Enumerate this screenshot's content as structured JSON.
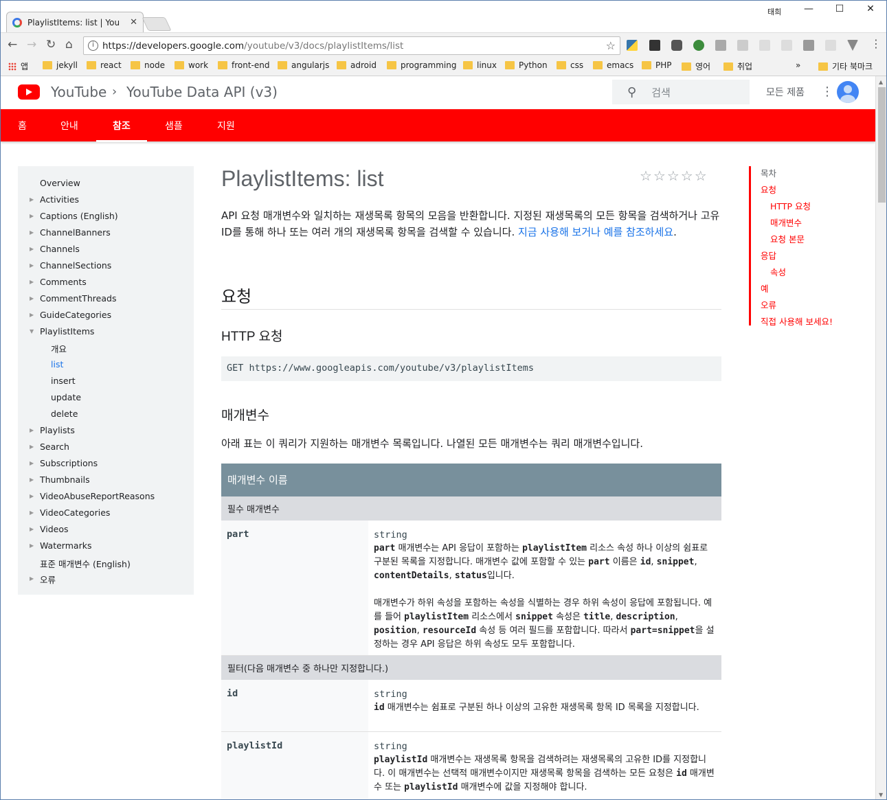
{
  "browser": {
    "tab_title": "PlaylistItems: list  |  You",
    "close_glyph": "✕",
    "profile_name": "태희",
    "window_buttons": [
      "—",
      "☐",
      "✕"
    ],
    "url_host": "https://developers.google.com",
    "url_path": "/youtube/v3/docs/playlistItems/list",
    "bookmarks": [
      "앱",
      "jekyll",
      "react",
      "node",
      "work",
      "front-end",
      "angularjs",
      "adroid",
      "programming",
      "linux",
      "Python",
      "css",
      "emacs",
      "PHP",
      "영어",
      "취업"
    ],
    "bookmarks_more": "»",
    "other_bookmarks": "기타 북마크",
    "icons": [
      "back-icon",
      "forward-icon",
      "reload-icon",
      "home-icon",
      "info-icon",
      "star-icon"
    ]
  },
  "header": {
    "brand": "YouTube",
    "separator": "›",
    "product": "YouTube Data API (v3)",
    "search_placeholder": "검색",
    "all_products": "모든 제품"
  },
  "nav": {
    "items": [
      "홈",
      "안내",
      "참조",
      "샘플",
      "지원"
    ],
    "active": "참조"
  },
  "sidebar": {
    "items": [
      {
        "label": "Overview"
      },
      {
        "label": "Activities"
      },
      {
        "label": "Captions (English)"
      },
      {
        "label": "ChannelBanners"
      },
      {
        "label": "Channels"
      },
      {
        "label": "ChannelSections"
      },
      {
        "label": "Comments"
      },
      {
        "label": "CommentThreads"
      },
      {
        "label": "GuideCategories"
      },
      {
        "label": "PlaylistItems"
      },
      {
        "label": "개요"
      },
      {
        "label": "list"
      },
      {
        "label": "insert"
      },
      {
        "label": "update"
      },
      {
        "label": "delete"
      },
      {
        "label": "Playlists"
      },
      {
        "label": "Search"
      },
      {
        "label": "Subscriptions"
      },
      {
        "label": "Thumbnails"
      },
      {
        "label": "VideoAbuseReportReasons"
      },
      {
        "label": "VideoCategories"
      },
      {
        "label": "Videos"
      },
      {
        "label": "Watermarks"
      },
      {
        "label": "표준 매개변수 (English)"
      },
      {
        "label": "오류"
      }
    ]
  },
  "page": {
    "title": "PlaylistItems: list",
    "rating_stars": "☆☆☆☆☆",
    "intro_text": "API 요청 매개변수와 일치하는 재생목록 항목의 모음을 반환합니다. 지정된 재생목록의 모든 항목을 검색하거나 고유 ID를 통해 하나 또는 여러 개의 재생목록 항목을 검색할 수 있습니다. ",
    "intro_link": "지금 사용해 보거나 예를 참조하세요",
    "intro_end": ".",
    "section_request": "요청",
    "http_request_heading": "HTTP 요청",
    "http_request": "GET https://www.googleapis.com/youtube/v3/playlistItems",
    "params_heading": "매개변수",
    "params_text": "아래 표는 이 쿼리가 지원하는 매개변수 목록입니다. 나열된 모든 매개변수는 쿼리 매개변수입니다.",
    "table": {
      "header": "매개변수 이름",
      "required_section": "필수 매개변수",
      "filter_section": "필터(다음 매개변수 중 하나만 지정합니다.)",
      "rows": [
        {
          "name": "part",
          "type": "string"
        },
        {
          "name": "id",
          "type": "string"
        },
        {
          "name": "playlistId",
          "type": "string"
        }
      ]
    }
  },
  "toc": {
    "heading": "목차",
    "items": [
      "요청",
      "HTTP 요청",
      "매개변수",
      "요청 본문",
      "응답",
      "속성",
      "예",
      "오류",
      "직접 사용해 보세요!"
    ]
  }
}
